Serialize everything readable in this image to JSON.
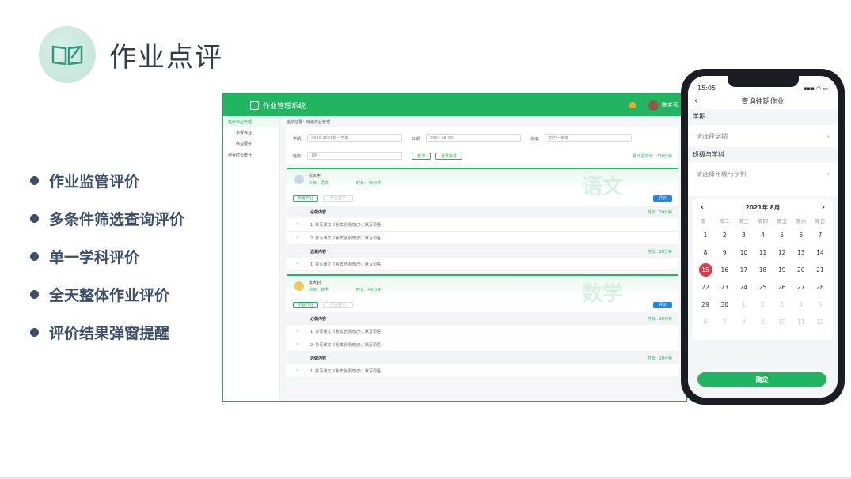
{
  "title": "作业点评",
  "features": [
    "作业监管评价",
    "多条件筛选查询评价",
    "单一学科评价",
    "全天整体作业评价",
    "评价结果弹窗提醒"
  ],
  "desktop": {
    "app_name": "作业管理系统",
    "user": "陈老师",
    "sidebar": [
      {
        "label": "班级作业管理",
        "active": true
      },
      {
        "label": "布置作业",
        "sub": true
      },
      {
        "label": "作业展示",
        "sub": true
      },
      {
        "label": "作业时长统计",
        "sub": false
      }
    ],
    "crumb": "当前位置：班级作业管理",
    "filters": {
      "term_label": "学期:",
      "term_value": "2020-2021第一学期",
      "date_label": "日期:",
      "date_value": "2021-08-20",
      "grade_label": "年级:",
      "grade_value": "初中一年级",
      "class_label": "班级:",
      "class_value": "1班",
      "search": "查询",
      "reset": "重置条件",
      "total": "累计总时长：120分钟"
    },
    "cards": [
      {
        "teacher": "张三丰",
        "subject": "科目：语文",
        "time": "时长：40分钟",
        "big": "语文",
        "btn1": "布置作业",
        "btn2": "作业展示",
        "btn3": "评价",
        "req_label": "必做内容",
        "req_time": "时长：20分钟",
        "req": [
          "1. 抄写课文《鲁滨逊漂流记》，默写词语",
          "2. 抄写课文《鲁滨逊漂流记》，默写词语"
        ],
        "opt_label": "选做内容",
        "opt_time": "时长：20分钟",
        "opt": [
          "1. 抄写课文《鲁滨逊漂流记》，默写词语"
        ]
      },
      {
        "teacher": "李大钊",
        "subject": "科目：数学",
        "time": "时长：40分钟",
        "big": "数学",
        "btn1": "布置作业",
        "btn2": "作业展示",
        "btn3": "评价",
        "req_label": "必做内容",
        "req_time": "时长：20分钟",
        "req": [
          "1. 抄写课文《鲁滨逊漂流记》，默写词语",
          "2. 抄写课文《鲁滨逊漂流记》，默写词语"
        ],
        "opt_label": "选做内容",
        "opt_time": "时长：20分钟",
        "opt": [
          "1. 抄写课文《鲁滨逊漂流记》，默写词语"
        ]
      }
    ]
  },
  "phone": {
    "time": "15:05",
    "title": "查询往期作业",
    "term_label": "学期",
    "term_placeholder": "请选择学期",
    "class_label": "班级与学科",
    "class_placeholder": "请选择年级与学科",
    "month": "2021年 8月",
    "weekdays": [
      "周一",
      "周二",
      "周三",
      "周四",
      "周五",
      "周六",
      "周日"
    ],
    "days": [
      "1",
      "2",
      "3",
      "4",
      "5",
      "6",
      "7",
      "8",
      "9",
      "10",
      "11",
      "12",
      "13",
      "14",
      "15",
      "16",
      "17",
      "18",
      "19",
      "20",
      "21",
      "22",
      "23",
      "24",
      "25",
      "26",
      "27",
      "28",
      "29",
      "30",
      "1",
      "2",
      "3",
      "4",
      "5",
      "6",
      "7",
      "8",
      "9",
      "10",
      "11",
      "12"
    ],
    "selected_day": "15",
    "confirm": "确定"
  }
}
